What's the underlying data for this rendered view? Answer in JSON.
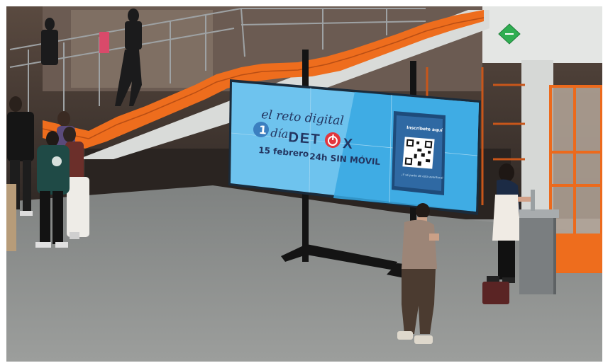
{
  "screen": {
    "line1": "el reto digital",
    "number": "1",
    "dia": "día",
    "brand_a": "DET",
    "brand_b": "X",
    "date": "15 febrero",
    "duration": "24h SIN MÓVIL",
    "phone_heading": "Inscríbete aquí",
    "phone_caption": "¡Y sé parte de esta aventura!"
  },
  "colors": {
    "screen_light": "#6ec3ee",
    "screen_dark": "#37a8e2",
    "text_navy": "#233560",
    "brand_red": "#e3353c",
    "stair_orange": "#ee6d1d",
    "floor": "#8f9190",
    "sign_green": "#2fae51"
  },
  "icons": [
    "power-icon",
    "qr-code-icon",
    "diamond-sign-icon"
  ]
}
